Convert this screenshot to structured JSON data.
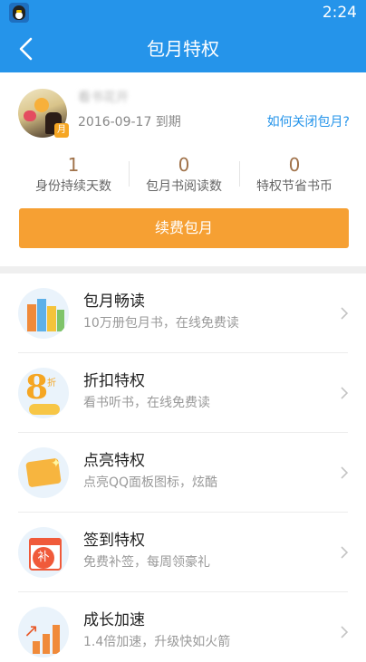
{
  "status_bar": {
    "time": "2:24",
    "app_icon": "qq-penguin-icon"
  },
  "header": {
    "title": "包月特权",
    "back_icon": "back-arrow-icon"
  },
  "profile": {
    "username": "看书花开",
    "expire_text": "2016-09-17 到期",
    "close_link": "如何关闭包月?",
    "badge": "月"
  },
  "stats": [
    {
      "value": "1",
      "label": "身份持续天数"
    },
    {
      "value": "0",
      "label": "包月书阅读数"
    },
    {
      "value": "0",
      "label": "特权节省书币"
    }
  ],
  "renew_button": "续费包月",
  "privileges": [
    {
      "title": "包月畅读",
      "subtitle": "10万册包月书，在线免费读",
      "icon": "books-icon"
    },
    {
      "title": "折扣特权",
      "subtitle": "看书听书，在线免费读",
      "icon": "discount-icon"
    },
    {
      "title": "点亮特权",
      "subtitle": "点亮QQ面板图标，炫酷",
      "icon": "light-up-icon"
    },
    {
      "title": "签到特权",
      "subtitle": "免费补签，每周领豪礼",
      "icon": "checkin-icon"
    },
    {
      "title": "成长加速",
      "subtitle": "1.4倍加速，升级快如火箭",
      "icon": "growth-icon"
    }
  ],
  "icon_glyphs": {
    "discount_number": "8",
    "discount_char": "折",
    "checkin_char": "补"
  },
  "colors": {
    "accent": "#2594ea",
    "button": "#f6a033",
    "stat_value": "#a0724a"
  }
}
